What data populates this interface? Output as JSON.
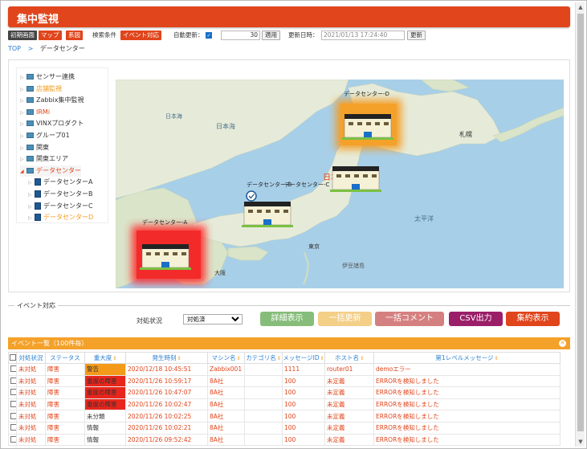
{
  "header": {
    "title": "集中監視"
  },
  "toolbar": {
    "btn_initial": "初期画面",
    "btn_map": "マップ",
    "btn_system": "系図",
    "btn_search": "検索条件",
    "btn_event": "イベント対応",
    "auto_update_label": "自動更新：",
    "auto_update_checked": true,
    "interval_value": "30",
    "apply_label": "適用",
    "updated_label": "更新日時：",
    "updated_value": "2021/01/13 17:24:40",
    "refresh_label": "更新"
  },
  "breadcrumb": {
    "top": "TOP",
    "sep": ">",
    "current": "データセンター"
  },
  "tree": {
    "items": [
      {
        "label": "センサー連携",
        "color": "normal"
      },
      {
        "label": "店舗監視",
        "color": "orange"
      },
      {
        "label": "Zabbix集中監視",
        "color": "normal"
      },
      {
        "label": "IRMi",
        "color": "red"
      },
      {
        "label": "VINXプロダクト",
        "color": "normal"
      },
      {
        "label": "グループ01",
        "color": "normal"
      },
      {
        "label": "関東",
        "color": "normal"
      },
      {
        "label": "関東エリア",
        "color": "normal"
      },
      {
        "label": "データセンター",
        "color": "red"
      },
      {
        "label": "データセンターA",
        "color": "normal"
      },
      {
        "label": "データセンターB",
        "color": "normal"
      },
      {
        "label": "データセンターC",
        "color": "normal"
      },
      {
        "label": "データセンターD",
        "color": "orange"
      }
    ]
  },
  "map": {
    "labels": {
      "sea_japan_en": "日本海",
      "sea_japan": "日本海",
      "japan": "日本",
      "pacific": "太平洋",
      "sapporo": "札幌",
      "tokyo": "東京",
      "osaka": "大阪",
      "izu": "伊豆諸島"
    },
    "markers": [
      {
        "label": "データセンター-D",
        "status": "orange"
      },
      {
        "label": "データセンター-C",
        "status": "none"
      },
      {
        "label": "データセンター-B",
        "status": "none"
      },
      {
        "label": "データセンター-A",
        "status": "red"
      }
    ]
  },
  "event_section": {
    "legend": "イベント対応",
    "filter_label": "対処状況",
    "filter_value": "対処済",
    "buttons": {
      "detail": "詳細表示",
      "bulk_update": "一括更新",
      "bulk_comment": "一括コメント",
      "csv": "CSV出力",
      "summary": "集約表示"
    }
  },
  "event_list": {
    "title": "イベント一覧（100件毎）",
    "columns": [
      "対処状況",
      "ステータス",
      "重大度",
      "発生時刻",
      "マシン名",
      "カテゴリ名",
      "メッセージID",
      "ホスト名",
      "第1レベルメッセージ"
    ],
    "rows": [
      {
        "status": "未対処",
        "state": "障害",
        "severity": "警告",
        "sev_color": "orange",
        "time": "2020/12/18 10:45:51",
        "machine": "Zabbix001",
        "category": "",
        "msgid": "1111",
        "host": "router01",
        "message": "demoエラー"
      },
      {
        "status": "未対処",
        "state": "障害",
        "severity": "重度の障害",
        "sev_color": "red",
        "time": "2020/11/26 10:59:17",
        "machine": "8A社",
        "category": "",
        "msgid": "100",
        "host": "未定義",
        "message": "ERRORを検知しました"
      },
      {
        "status": "未対処",
        "state": "障害",
        "severity": "重度の障害",
        "sev_color": "red",
        "time": "2020/11/26 10:47:07",
        "machine": "8A社",
        "category": "",
        "msgid": "100",
        "host": "未定義",
        "message": "ERRORを検知しました"
      },
      {
        "status": "未対処",
        "state": "障害",
        "severity": "重度の障害",
        "sev_color": "red",
        "time": "2020/11/26 10:02:47",
        "machine": "8A社",
        "category": "",
        "msgid": "100",
        "host": "未定義",
        "message": "ERRORを検知しました"
      },
      {
        "status": "未対処",
        "state": "障害",
        "severity": "未分類",
        "sev_color": "none",
        "time": "2020/11/26 10:02:25",
        "machine": "8A社",
        "category": "",
        "msgid": "100",
        "host": "未定義",
        "message": "ERRORを検知しました"
      },
      {
        "status": "未対処",
        "state": "障害",
        "severity": "情報",
        "sev_color": "none",
        "time": "2020/11/26 10:02:21",
        "machine": "8A社",
        "category": "",
        "msgid": "100",
        "host": "未定義",
        "message": "ERRORを検知しました"
      },
      {
        "status": "未対処",
        "state": "障害",
        "severity": "情報",
        "sev_color": "none",
        "time": "2020/11/26 09:52:42",
        "machine": "8A社",
        "category": "",
        "msgid": "100",
        "host": "未定義",
        "message": "ERRORを検知しました"
      }
    ]
  },
  "colors": {
    "brand": "#e0451b",
    "orange": "#f49a1a",
    "red": "#e8261c",
    "link": "#2a7fd0"
  }
}
